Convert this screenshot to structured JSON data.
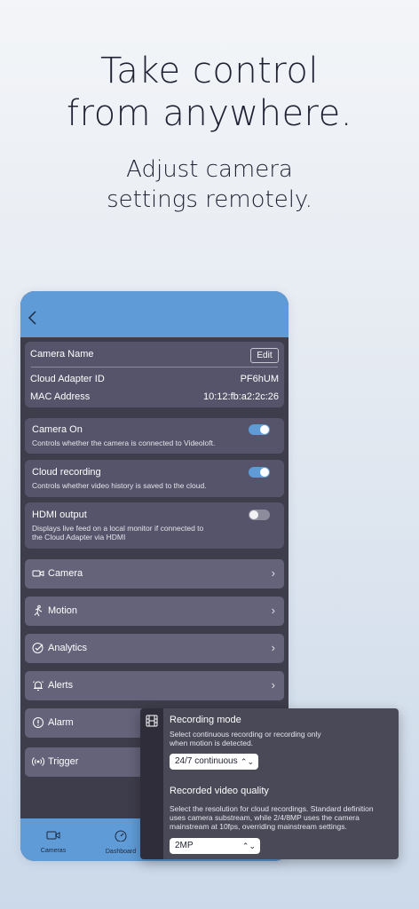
{
  "headline": {
    "line1": "Take control",
    "line2": "from anywhere."
  },
  "subhead": {
    "line1": "Adjust camera",
    "line2": "settings remotely."
  },
  "settings": {
    "camera_name_label": "Camera Name",
    "edit_label": "Edit",
    "adapter_id_label": "Cloud Adapter ID",
    "adapter_id_value": "PF6hUM",
    "mac_label": "MAC Address",
    "mac_value": "10:12:fb:a2:2c:26"
  },
  "toggles": [
    {
      "title": "Camera On",
      "desc1": "Controls whether the camera is connected to Videoloft.",
      "desc2": "",
      "state": true
    },
    {
      "title": "Cloud recording",
      "desc1": "Controls whether video history is saved to the cloud.",
      "desc2": "",
      "state": true
    },
    {
      "title": "HDMI output",
      "desc1": "Displays live feed on a local monitor if connected to",
      "desc2": "the Cloud Adapter via HDMI",
      "state": false
    }
  ],
  "nav": [
    {
      "label": "Camera",
      "icon": "camera-icon"
    },
    {
      "label": "Motion",
      "icon": "motion-icon"
    },
    {
      "label": "Analytics",
      "icon": "analytics-icon"
    },
    {
      "label": "Alerts",
      "icon": "bell-icon"
    },
    {
      "label": "Alarm",
      "icon": "alarm-icon"
    },
    {
      "label": "Trigger",
      "icon": "trigger-icon"
    }
  ],
  "tabbar": {
    "cameras": "Cameras",
    "dashboard": "Dashboard"
  },
  "popover": {
    "mode_title": "Recording mode",
    "mode_desc1": "Select continuous recording or recording only",
    "mode_desc2": "when motion is detected.",
    "mode_value": "24/7 continuous",
    "quality_title": "Recorded video quality",
    "quality_desc1": "Select the resolution for cloud recordings. Standard definition",
    "quality_desc2": "uses camera substream, while 2/4/8MP uses the camera",
    "quality_desc3": "mainstream at 10fps, overriding mainstream settings.",
    "quality_value": "2MP"
  },
  "colors": {
    "accent": "#5f9bd6",
    "panel": "#3e3d4b",
    "card": "#55546a",
    "row": "#64637a"
  }
}
